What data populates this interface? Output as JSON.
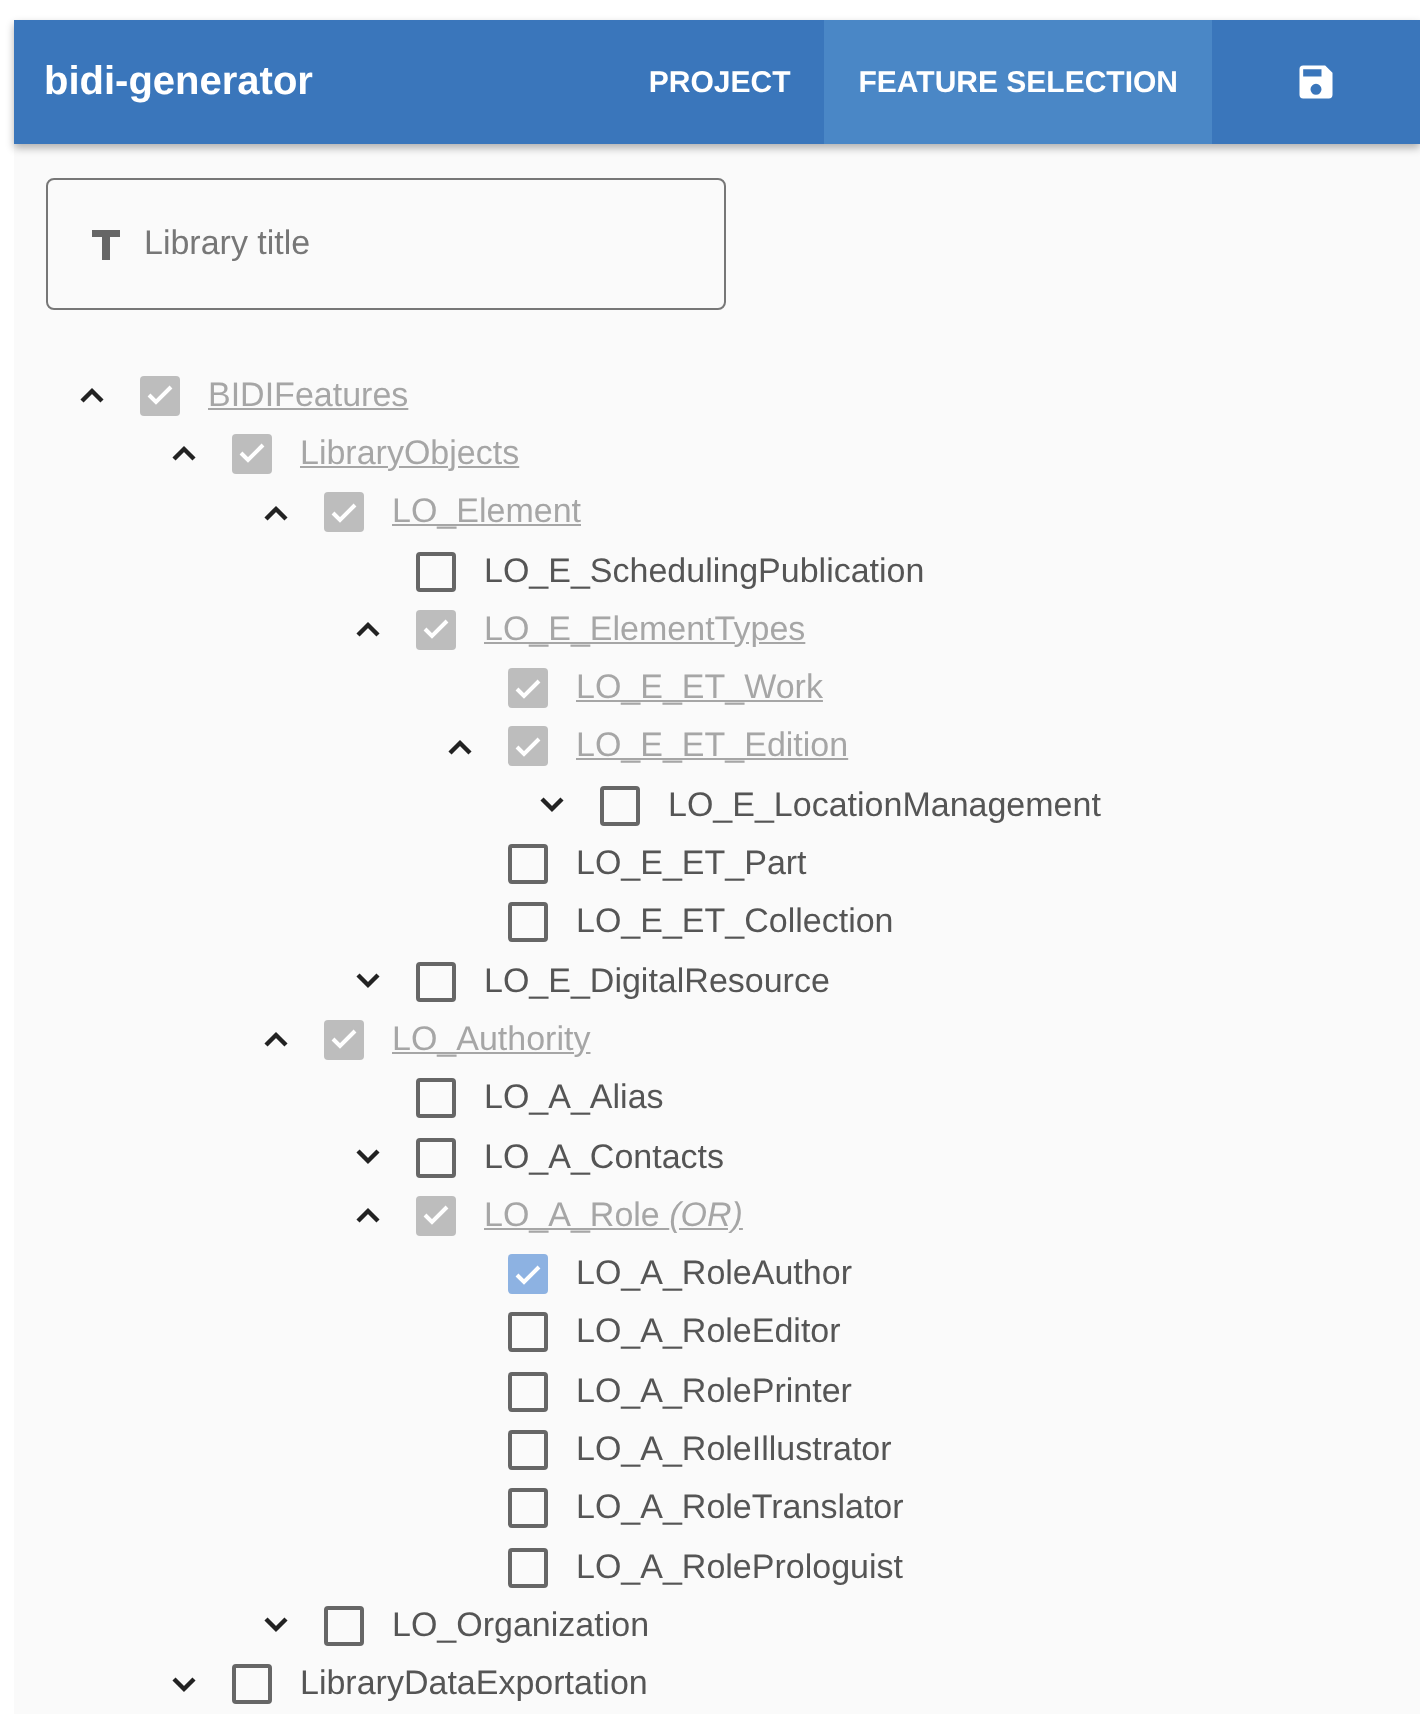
{
  "app_bar": {
    "title": "bidi-generator",
    "tabs": [
      {
        "label": "PROJECT",
        "selected": false
      },
      {
        "label": "FEATURE SELECTION",
        "selected": true
      }
    ]
  },
  "title_field": {
    "placeholder": "Library title"
  },
  "tree": [
    {
      "label": "BIDIFeatures",
      "checked": true,
      "mandatory": true,
      "expanded": true,
      "children": [
        {
          "label": "LibraryObjects",
          "checked": true,
          "mandatory": true,
          "expanded": true,
          "children": [
            {
              "label": "LO_Element",
              "checked": true,
              "mandatory": true,
              "expanded": true,
              "children": [
                {
                  "label": "LO_E_SchedulingPublication",
                  "checked": false,
                  "mandatory": false
                },
                {
                  "label": "LO_E_ElementTypes",
                  "checked": true,
                  "mandatory": true,
                  "expanded": true,
                  "children": [
                    {
                      "label": "LO_E_ET_Work",
                      "checked": true,
                      "mandatory": true
                    },
                    {
                      "label": "LO_E_ET_Edition",
                      "checked": true,
                      "mandatory": true,
                      "expanded": true,
                      "children": [
                        {
                          "label": "LO_E_LocationManagement",
                          "checked": false,
                          "mandatory": false,
                          "expanded": false
                        }
                      ]
                    },
                    {
                      "label": "LO_E_ET_Part",
                      "checked": false,
                      "mandatory": false
                    },
                    {
                      "label": "LO_E_ET_Collection",
                      "checked": false,
                      "mandatory": false
                    }
                  ]
                },
                {
                  "label": "LO_E_DigitalResource",
                  "checked": false,
                  "mandatory": false,
                  "expanded": false
                }
              ]
            },
            {
              "label": "LO_Authority",
              "checked": true,
              "mandatory": true,
              "expanded": true,
              "children": [
                {
                  "label": "LO_A_Alias",
                  "checked": false,
                  "mandatory": false
                },
                {
                  "label": "LO_A_Contacts",
                  "checked": false,
                  "mandatory": false,
                  "expanded": false
                },
                {
                  "label": "LO_A_Role *(OR)*",
                  "checked": true,
                  "mandatory": true,
                  "expanded": true,
                  "children": [
                    {
                      "label": "LO_A_RoleAuthor",
                      "checked": true,
                      "mandatory": false
                    },
                    {
                      "label": "LO_A_RoleEditor",
                      "checked": false,
                      "mandatory": false
                    },
                    {
                      "label": "LO_A_RolePrinter",
                      "checked": false,
                      "mandatory": false
                    },
                    {
                      "label": "LO_A_RoleIllustrator",
                      "checked": false,
                      "mandatory": false
                    },
                    {
                      "label": "LO_A_RoleTranslator",
                      "checked": false,
                      "mandatory": false
                    },
                    {
                      "label": "LO_A_RoleProloguist",
                      "checked": false,
                      "mandatory": false
                    }
                  ]
                }
              ]
            },
            {
              "label": "LO_Organization",
              "checked": false,
              "mandatory": false,
              "expanded": false
            }
          ]
        },
        {
          "label": "LibraryDataExportation",
          "checked": false,
          "mandatory": false,
          "expanded": false
        }
      ]
    }
  ]
}
